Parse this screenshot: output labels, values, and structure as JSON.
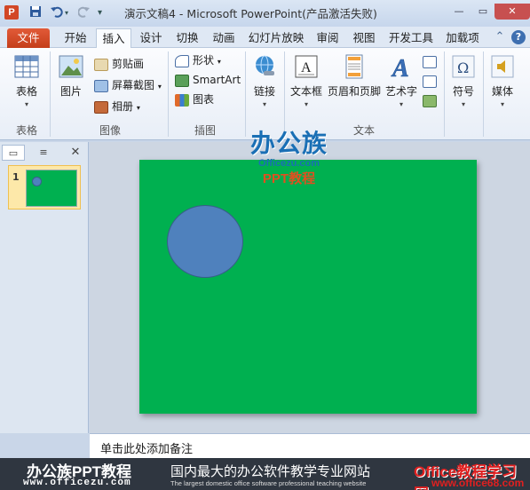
{
  "app": {
    "title": "演示文稿4  -  Microsoft PowerPoint(产品激活失败)",
    "app_icon_letter": "P",
    "qat": {
      "save_icon": "save-icon",
      "undo_icon": "undo-icon",
      "redo_icon": "redo-icon",
      "customize_icon": "customize-qat-icon"
    }
  },
  "tabs": [
    {
      "label": "文件"
    },
    {
      "label": "开始"
    },
    {
      "label": "插入"
    },
    {
      "label": "设计"
    },
    {
      "label": "切换"
    },
    {
      "label": "动画"
    },
    {
      "label": "幻灯片放映"
    },
    {
      "label": "审阅"
    },
    {
      "label": "视图"
    },
    {
      "label": "开发工具"
    },
    {
      "label": "加载项"
    }
  ],
  "ribbon": {
    "groups": {
      "tables": {
        "label": "表格",
        "table_btn": "表格"
      },
      "images": {
        "label": "图像",
        "picture_btn": "图片",
        "clipart_btn": "剪贴画",
        "screenshot_btn": "屏幕截图",
        "album_btn": "相册"
      },
      "illustrations": {
        "label": "插图",
        "shapes_btn": "形状",
        "smartart_btn": "SmartArt",
        "chart_btn": "图表"
      },
      "links": {
        "link_btn": "链接"
      },
      "text": {
        "label": "文本",
        "textbox_btn": "文本框",
        "headerfooter_btn": "页眉和页脚",
        "wordart_btn": "艺术字"
      },
      "symbols": {
        "symbol_btn": "符号"
      },
      "media": {
        "media_btn": "媒体"
      }
    }
  },
  "thumbnails": [
    {
      "number": "1"
    }
  ],
  "notes_placeholder": "单击此处添加备注",
  "watermark": {
    "logo": "办公族",
    "domain": "Officezu.com",
    "subtitle": "PPT教程"
  },
  "footer": {
    "brand": "办公族PPT教程",
    "url": "www.officezu.com",
    "tagline_cn": "国内最大的办公软件教学专业网站",
    "tagline_en": "The largest domestic office software professional teaching website",
    "right_brand": "Office教程学习网",
    "right_url": "www.office68.com"
  },
  "colors": {
    "slide_background": "#00b050",
    "circle_fill": "#4f81bd",
    "file_tab": "#d24726"
  }
}
